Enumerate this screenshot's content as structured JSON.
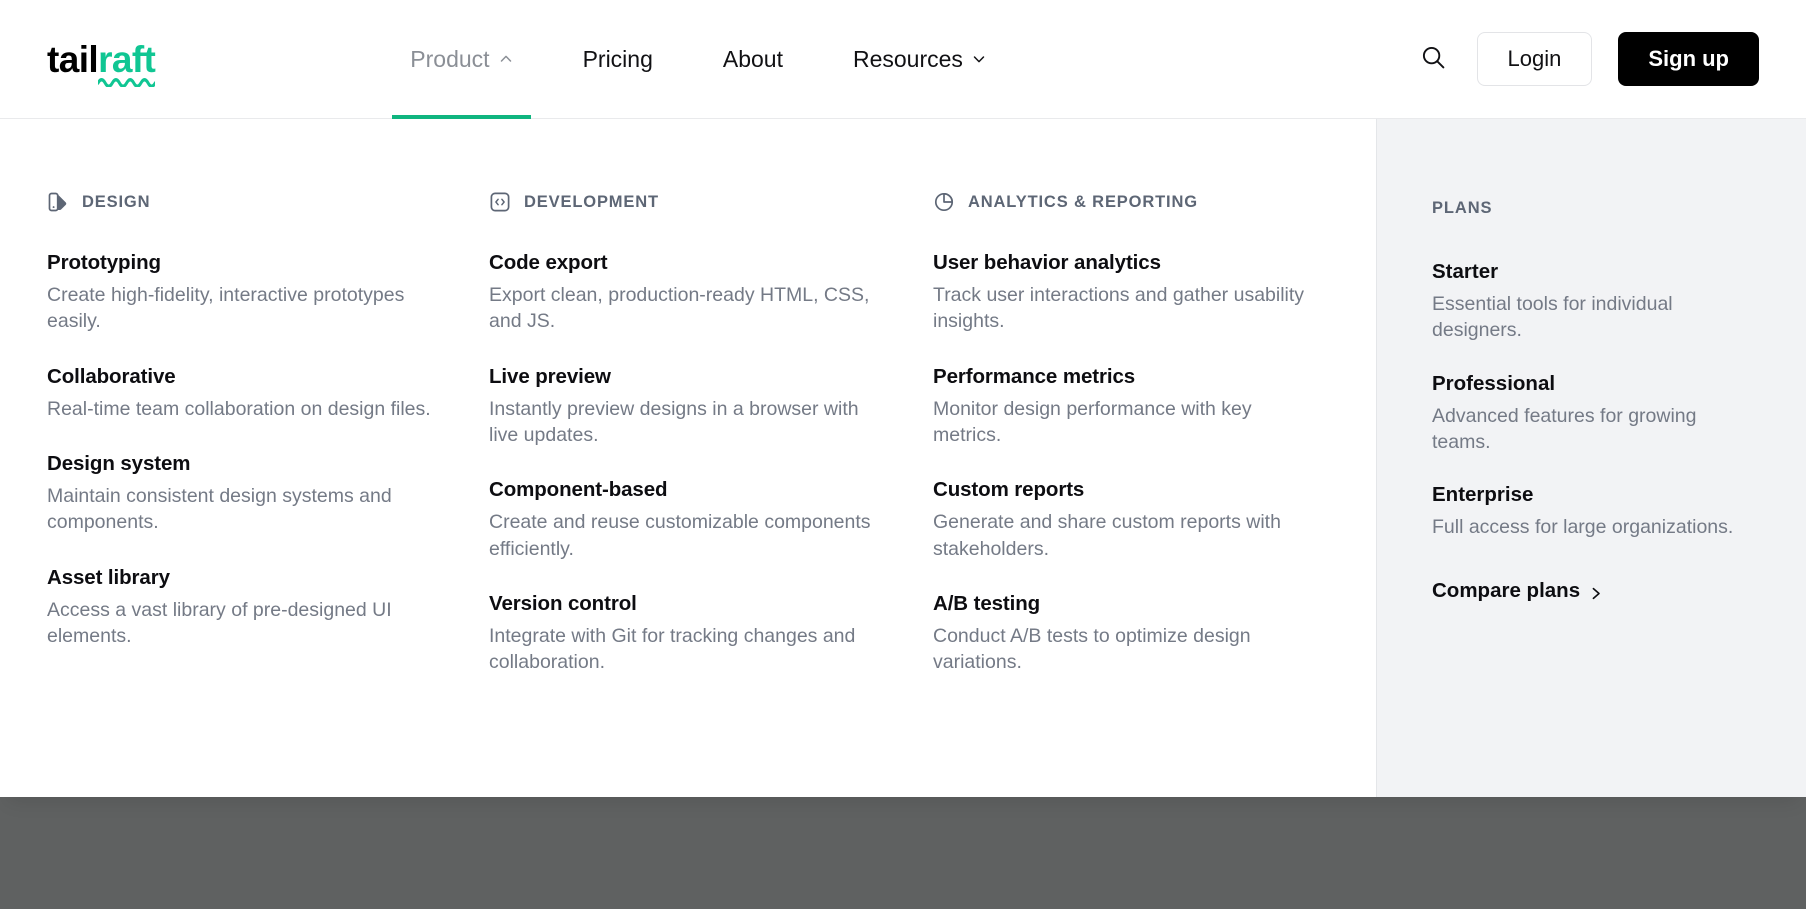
{
  "brand": {
    "name_first": "tail",
    "name_second": "raft"
  },
  "nav": {
    "items": [
      {
        "label": "Product",
        "icon": "chevron-up-icon",
        "active": true
      },
      {
        "label": "Pricing",
        "icon": "",
        "active": false
      },
      {
        "label": "About",
        "icon": "",
        "active": false
      },
      {
        "label": "Resources",
        "icon": "chevron-down-icon",
        "active": false
      }
    ],
    "search_icon": "search-icon",
    "login_label": "Login",
    "signup_label": "Sign up"
  },
  "colors": {
    "accent_green": "#0fb57f",
    "logo_green": "#10c693",
    "signup_bg": "#000000",
    "sidebar_bg": "#f2f3f5",
    "heading_gray": "#5d6675",
    "body_gray": "#747a86",
    "scrim": "#5f6161"
  },
  "mega_menu": {
    "columns": [
      {
        "heading": "DESIGN",
        "icon": "design-tool-icon",
        "items": [
          {
            "title": "Prototyping",
            "desc": "Create high-fidelity, interactive prototypes easily."
          },
          {
            "title": "Collaborative",
            "desc": "Real-time team collaboration on design files."
          },
          {
            "title": "Design system",
            "desc": "Maintain consistent design systems and components."
          },
          {
            "title": "Asset library",
            "desc": "Access a vast library of pre-designed UI elements."
          }
        ]
      },
      {
        "heading": "DEVELOPMENT",
        "icon": "code-brackets-icon",
        "items": [
          {
            "title": "Code export",
            "desc": "Export clean, production-ready HTML, CSS, and JS."
          },
          {
            "title": "Live preview",
            "desc": "Instantly preview designs in a browser with live updates."
          },
          {
            "title": "Component-based",
            "desc": "Create and reuse customizable components efficiently."
          },
          {
            "title": "Version control",
            "desc": "Integrate with Git for tracking changes and collaboration."
          }
        ]
      },
      {
        "heading": "ANALYTICS & REPORTING",
        "icon": "pie-chart-icon",
        "items": [
          {
            "title": "User behavior analytics",
            "desc": "Track user interactions and gather usability insights."
          },
          {
            "title": "Performance metrics",
            "desc": "Monitor design performance with key metrics."
          },
          {
            "title": "Custom reports",
            "desc": "Generate and share custom reports with stakeholders."
          },
          {
            "title": "A/B testing",
            "desc": "Conduct A/B tests to optimize design variations."
          }
        ]
      }
    ],
    "plans": {
      "heading": "PLANS",
      "items": [
        {
          "title": "Starter",
          "desc": "Essential tools for individual designers."
        },
        {
          "title": "Professional",
          "desc": "Advanced features for growing teams."
        },
        {
          "title": "Enterprise",
          "desc": "Full access for large organizations."
        }
      ],
      "compare_label": "Compare plans",
      "compare_icon": "chevron-right-icon"
    }
  }
}
